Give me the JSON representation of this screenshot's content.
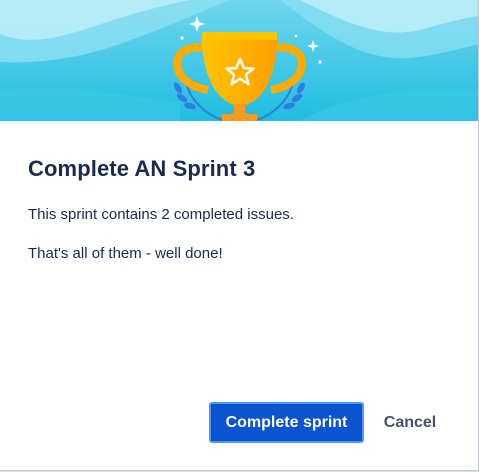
{
  "dialog": {
    "title": "Complete AN Sprint 3",
    "summary": "This sprint contains 2 completed issues.",
    "message": "That's all of them - well done!",
    "primary_button_label": "Complete sprint",
    "cancel_button_label": "Cancel"
  },
  "icons": {
    "header_illustration": "trophy-icon",
    "trophy_emblem": "star-icon",
    "decorations": [
      "sparkle-icon",
      "laurel-icon"
    ]
  },
  "colors": {
    "header_sky_light": "#b7ecf7",
    "header_sky_dark": "#1fbde0",
    "trophy_gold": "#ffab00",
    "primary_button": "#0c54cf",
    "focus_ring": "#4c9aff",
    "text_primary": "#172b4d",
    "text_secondary": "#42526e"
  }
}
